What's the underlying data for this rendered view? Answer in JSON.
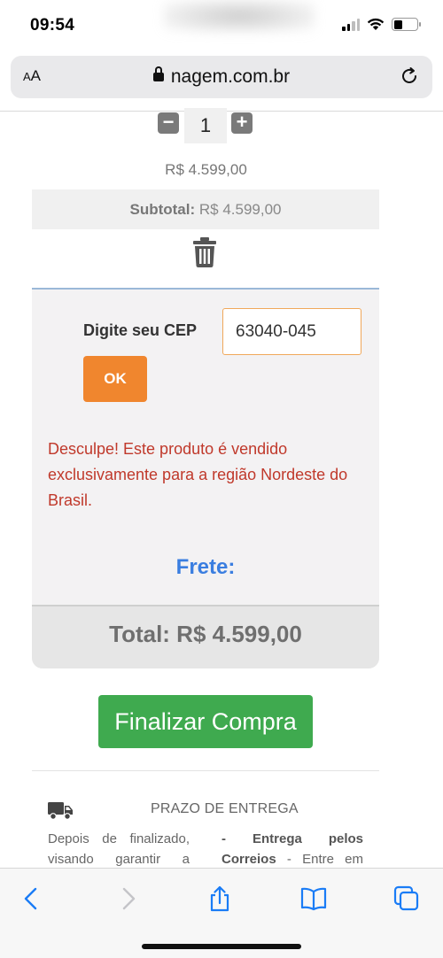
{
  "status_bar": {
    "time": "09:54"
  },
  "browser": {
    "text_size_label_small": "A",
    "text_size_label_large": "A",
    "url": "nagem.com.br"
  },
  "cart": {
    "quantity": "1",
    "minus_label": "−",
    "plus_label": "+",
    "unit_price": "R$ 4.599,00",
    "subtotal_label": "Subtotal:",
    "subtotal_value": "R$ 4.599,00"
  },
  "shipping": {
    "cep_label": "Digite seu CEP",
    "cep_value": "63040-045",
    "ok_label": "OK",
    "error_message": "Desculpe! Este produto é vendido exclusivamente para a região Nordeste do Brasil.",
    "frete_label": "Frete:",
    "total_text": "Total: R$ 4.599,00"
  },
  "checkout": {
    "finalize_label": "Finalizar Compra"
  },
  "delivery": {
    "title": "PRAZO DE ENTREGA",
    "left_text": "Depois de finalizado, visando garantir a",
    "right_bold": "- Entrega pelos Correios",
    "right_text": " - Entre em"
  },
  "colors": {
    "accent_orange": "#f0862e",
    "error_red": "#c0392b",
    "frete_blue": "#3a7ee0",
    "finalize_green": "#3faa4f",
    "ios_blue": "#1a7cf6"
  },
  "icons": {
    "trash": "trash-icon",
    "truck": "truck-icon",
    "lock": "lock-icon",
    "reload": "reload-icon",
    "back": "back-icon",
    "forward": "forward-icon",
    "share": "share-icon",
    "bookmarks": "bookmarks-icon",
    "tabs": "tabs-icon"
  }
}
